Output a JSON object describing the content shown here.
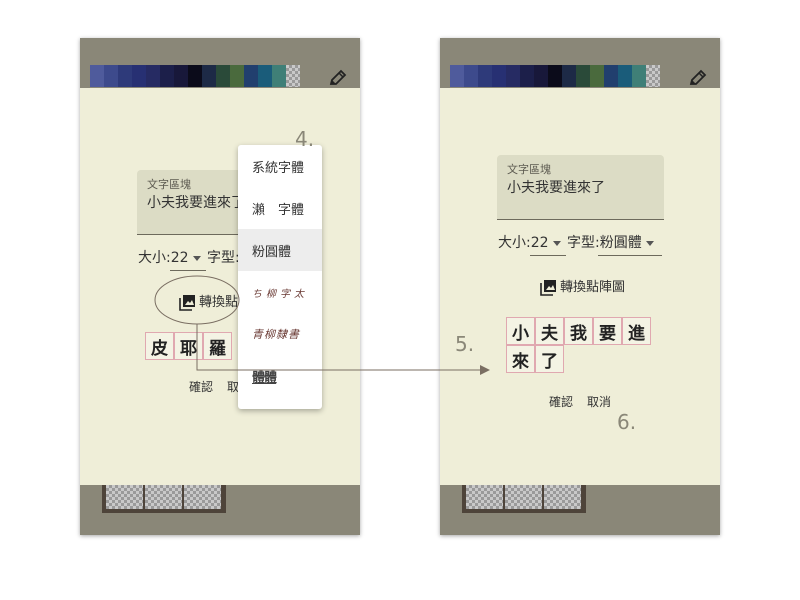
{
  "palette_colors": [
    "#4f5b9c",
    "#3d4a8c",
    "#2e3a7a",
    "#273073",
    "#262b63",
    "#1c1f4a",
    "#18183a",
    "#0b0b1a",
    "#1d2a46",
    "#2a4a39",
    "#4a6a3d",
    "#213f6e",
    "#1a5c7a",
    "#3f7f77",
    "checker"
  ],
  "left": {
    "textarea": {
      "label": "文字區塊",
      "value": "小夫我要進來了"
    },
    "size_label": "大小:22",
    "font_label": "字型:",
    "convert_label": "轉換點",
    "chars": [
      "皮",
      "耶",
      "羅"
    ],
    "confirm_label": "確認",
    "cancel_label": "取"
  },
  "dropdown": {
    "items": [
      {
        "label": "系統字體",
        "style": "normal"
      },
      {
        "label": "瀨　字體",
        "style": "normal"
      },
      {
        "label": "粉圓體",
        "style": "selected"
      },
      {
        "label": "ち柳字太",
        "style": "script1"
      },
      {
        "label": "青柳隸書",
        "style": "script2"
      },
      {
        "label": "體體",
        "style": "pixel"
      }
    ]
  },
  "right": {
    "textarea": {
      "label": "文字區塊",
      "value": "小夫我要進來了"
    },
    "size_label": "大小:22",
    "font_label": "字型:粉圓體",
    "convert_label": "轉換點陣圖",
    "chars": [
      "小",
      "夫",
      "我",
      "要",
      "進",
      "來",
      "了"
    ],
    "confirm_label": "確認",
    "cancel_label": "取消"
  },
  "steps": [
    "4.",
    "5.",
    "6."
  ],
  "colors": {
    "screen_bg": "#efeed8",
    "bar_bg": "#8a8778",
    "textarea_bg": "#dcdcc5",
    "cell_border": "#e0a8b0",
    "annotation": "#7a6e62"
  }
}
